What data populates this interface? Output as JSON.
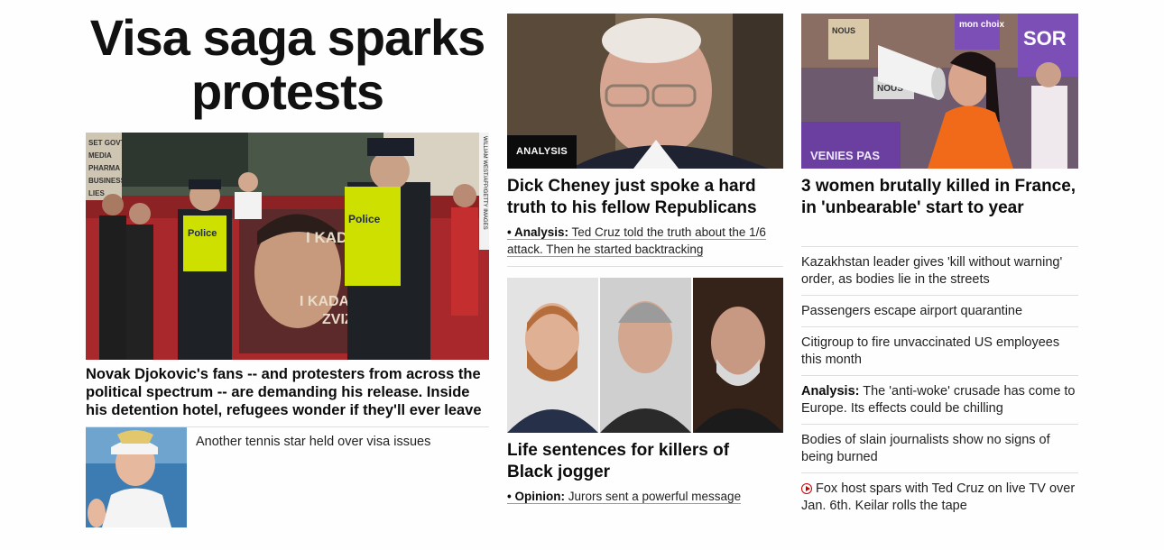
{
  "lead": {
    "headline": "Visa saga sparks protests",
    "caption": "Novak Djokovic's fans -- and protesters from across the political spectrum -- are demanding his release. Inside his detention hotel, refugees wonder if they'll ever leave",
    "photo_credit": "WILLIAM WEST/AFP/GETTY IMAGES",
    "image_signs": [
      "I KADA",
      "I KADA",
      "ZVIZ",
      "Police",
      "Police",
      "SET GOVT",
      "MEDIA",
      "PHARMA",
      "BUSINESS",
      "LIES"
    ],
    "related": {
      "text": "Another tennis star held over visa issues"
    }
  },
  "cheney": {
    "badge": "ANALYSIS",
    "title": "Dick Cheney just spoke a hard truth to his fellow Republicans",
    "sub_prefix": "Analysis:",
    "sub_text": "Ted Cruz told the truth about the 1/6 attack. Then he started backtracking"
  },
  "arbery": {
    "title": "Life sentences for killers of Black jogger",
    "sub_prefix": "Opinion:",
    "sub_text": "Jurors sent a powerful message"
  },
  "france": {
    "title": "3 women brutally killed in France, in 'unbearable' start to year",
    "image_signs": [
      "NOUS",
      "mon choix",
      "SOR",
      "NOUS",
      "VENIES PAS"
    ],
    "headlines": [
      {
        "prefix": "",
        "text": "Kazakhstan leader gives 'kill without warning' order, as bodies lie in the streets",
        "icon": ""
      },
      {
        "prefix": "",
        "text": "Passengers escape airport quarantine",
        "icon": ""
      },
      {
        "prefix": "",
        "text": "Citigroup to fire unvaccinated US employees this month",
        "icon": ""
      },
      {
        "prefix": "Analysis:",
        "text": "The 'anti-woke' crusade has come to Europe. Its effects could be chilling",
        "icon": ""
      },
      {
        "prefix": "",
        "text": "Bodies of slain journalists show no signs of being burned",
        "icon": ""
      },
      {
        "prefix": "",
        "text": "Fox host spars with Ted Cruz on live TV over Jan. 6th. Keilar rolls the tape",
        "icon": "play-icon"
      }
    ]
  },
  "colors": {
    "text": "#0c0c0c",
    "rule": "#dedede",
    "badge_bg": "#0c0c0c",
    "video_red": "#cc0000",
    "police_vest": "#cde000",
    "protest_purple": "#6b3fa0"
  }
}
